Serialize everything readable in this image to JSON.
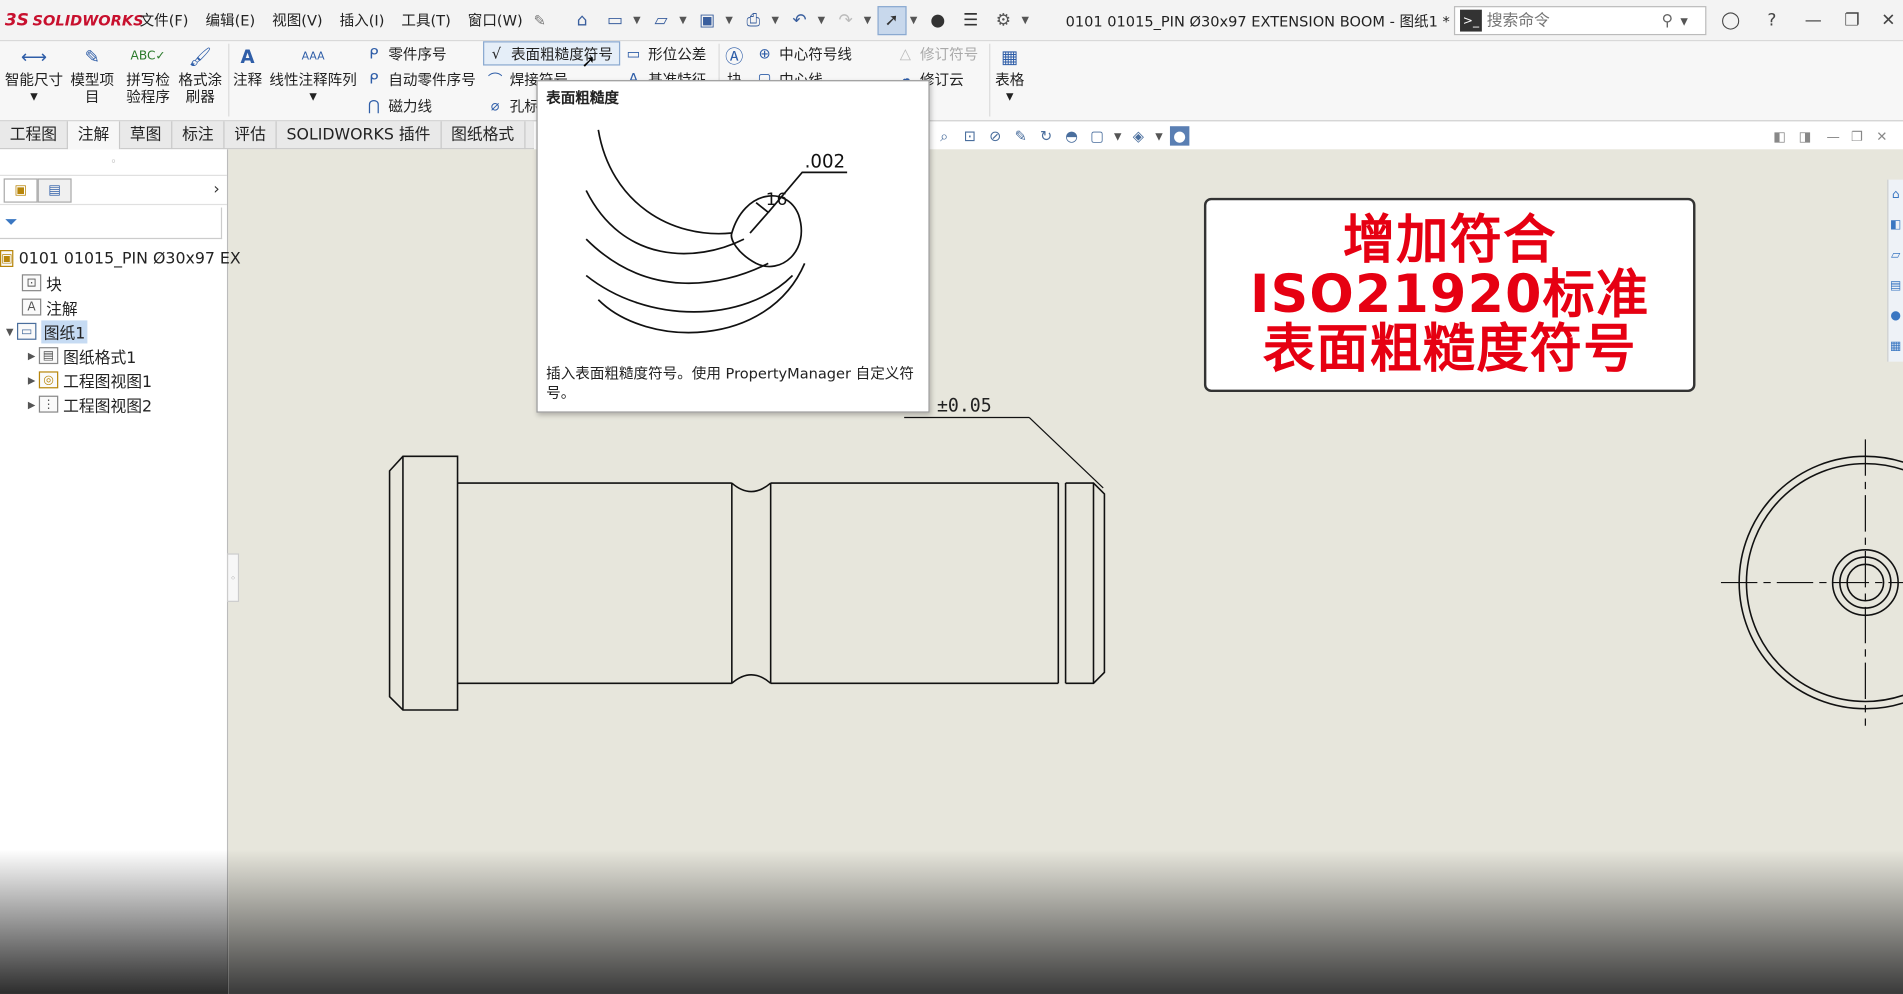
{
  "app": {
    "logo": "SOLIDWORKS",
    "logo_mark": "3S",
    "document_title": "0101 01015_PIN Ø30x97 EXTENSION BOOM - 图纸1 *"
  },
  "menu": [
    "文件(F)",
    "编辑(E)",
    "视图(V)",
    "插入(I)",
    "工具(T)",
    "窗口(W)"
  ],
  "search": {
    "placeholder": "搜索命令"
  },
  "ribbon": {
    "smart_dimension": "智能尺寸",
    "model_items": "模型项\n目",
    "spell_checker": "拼写检\n验程序",
    "format_painter": "格式涂\n刷器",
    "note": "注释",
    "linear_note_pattern": "线性注释阵列",
    "balloon": "零件序号",
    "auto_balloon": "自动零件序号",
    "magnetic_line": "磁力线",
    "surface_finish": "表面粗糙度符号",
    "weld_symbol": "焊接符号",
    "hole_callout": "孔标注",
    "gtol": "形位公差",
    "datum_feature": "基准特征",
    "block": "块",
    "center_mark": "中心符号线",
    "centerline": "中心线",
    "revision_symbol": "修订符号",
    "revision_cloud": "修订云",
    "tables": "表格"
  },
  "tabs": [
    {
      "label": "工程图",
      "active": false
    },
    {
      "label": "注解",
      "active": true
    },
    {
      "label": "草图",
      "active": false
    },
    {
      "label": "标注",
      "active": false
    },
    {
      "label": "评估",
      "active": false
    },
    {
      "label": "SOLIDWORKS 插件",
      "active": false
    },
    {
      "label": "图纸格式",
      "active": false
    }
  ],
  "tree": {
    "root": "0101 01015_PIN Ø30x97 EX",
    "items": [
      "块",
      "注解",
      "图纸1",
      "图纸格式1",
      "工程图视图1",
      "工程图视图2"
    ]
  },
  "tooltip": {
    "title": "表面粗糙度",
    "desc": "插入表面粗糙度符号。使用 PropertyManager 自定义符号。",
    "illus_value1": ".002",
    "illus_value2": "16"
  },
  "drawing": {
    "tolerance": "±0.05"
  },
  "callout": {
    "line1": "增加符合",
    "line2": "ISO21920标准",
    "line3": "表面粗糙度符号"
  },
  "colors": {
    "accent": "#2f5ea8",
    "callout_text": "#e60012",
    "sheet_bg": "#e7e6dc",
    "brand": "#c8102e"
  }
}
